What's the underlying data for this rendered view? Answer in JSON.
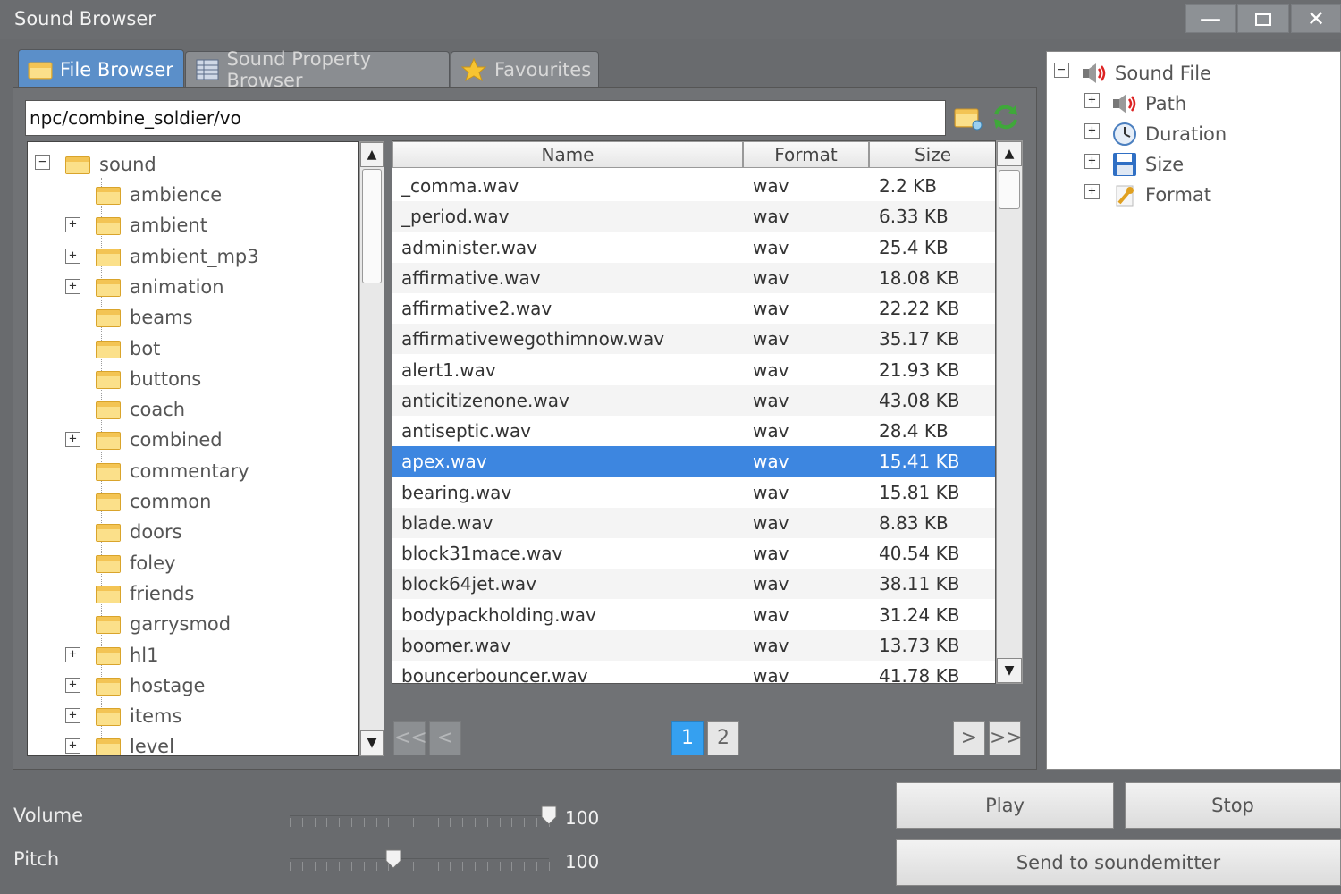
{
  "window": {
    "title": "Sound Browser"
  },
  "tabs": [
    {
      "label": "File Browser",
      "icon": "folder-icon",
      "active": true
    },
    {
      "label": "Sound Property Browser",
      "icon": "table-icon",
      "active": false
    },
    {
      "label": "Favourites",
      "icon": "star-icon",
      "active": false
    }
  ],
  "path": {
    "value": "npc/combine_soldier/vo"
  },
  "tree": {
    "root": "sound",
    "children": [
      {
        "label": "ambience",
        "expandable": false
      },
      {
        "label": "ambient",
        "expandable": true
      },
      {
        "label": "ambient_mp3",
        "expandable": true
      },
      {
        "label": "animation",
        "expandable": true
      },
      {
        "label": "beams",
        "expandable": false
      },
      {
        "label": "bot",
        "expandable": false
      },
      {
        "label": "buttons",
        "expandable": false
      },
      {
        "label": "coach",
        "expandable": false
      },
      {
        "label": "combined",
        "expandable": true
      },
      {
        "label": "commentary",
        "expandable": false
      },
      {
        "label": "common",
        "expandable": false
      },
      {
        "label": "doors",
        "expandable": false
      },
      {
        "label": "foley",
        "expandable": false
      },
      {
        "label": "friends",
        "expandable": false
      },
      {
        "label": "garrysmod",
        "expandable": false
      },
      {
        "label": "hl1",
        "expandable": true
      },
      {
        "label": "hostage",
        "expandable": true
      },
      {
        "label": "items",
        "expandable": true
      },
      {
        "label": "level",
        "expandable": true
      }
    ]
  },
  "filelist": {
    "columns": [
      "Name",
      "Format",
      "Size"
    ],
    "rows": [
      {
        "name": "_comma.wav",
        "format": "wav",
        "size": "2.2 KB"
      },
      {
        "name": "_period.wav",
        "format": "wav",
        "size": "6.33 KB"
      },
      {
        "name": "administer.wav",
        "format": "wav",
        "size": "25.4 KB"
      },
      {
        "name": "affirmative.wav",
        "format": "wav",
        "size": "18.08 KB"
      },
      {
        "name": "affirmative2.wav",
        "format": "wav",
        "size": "22.22 KB"
      },
      {
        "name": "affirmativewegothimnow.wav",
        "format": "wav",
        "size": "35.17 KB"
      },
      {
        "name": "alert1.wav",
        "format": "wav",
        "size": "21.93 KB"
      },
      {
        "name": "anticitizenone.wav",
        "format": "wav",
        "size": "43.08 KB"
      },
      {
        "name": "antiseptic.wav",
        "format": "wav",
        "size": "28.4 KB"
      },
      {
        "name": "apex.wav",
        "format": "wav",
        "size": "15.41 KB",
        "selected": true
      },
      {
        "name": "bearing.wav",
        "format": "wav",
        "size": "15.81 KB"
      },
      {
        "name": "blade.wav",
        "format": "wav",
        "size": "8.83 KB"
      },
      {
        "name": "block31mace.wav",
        "format": "wav",
        "size": "40.54 KB"
      },
      {
        "name": "block64jet.wav",
        "format": "wav",
        "size": "38.11 KB"
      },
      {
        "name": "bodypackholding.wav",
        "format": "wav",
        "size": "31.24 KB"
      },
      {
        "name": "boomer.wav",
        "format": "wav",
        "size": "13.73 KB"
      },
      {
        "name": "bouncerbouncer.wav",
        "format": "wav",
        "size": "41.78 KB"
      }
    ]
  },
  "pager": {
    "first": "<<",
    "prev": "<",
    "pages": [
      "1",
      "2"
    ],
    "current_page": "1",
    "next": ">",
    "last": ">>"
  },
  "properties": {
    "root": "Sound File",
    "items": [
      "Path",
      "Duration",
      "Size",
      "Format"
    ]
  },
  "controls": {
    "volume": {
      "label": "Volume",
      "value": "100",
      "level": 1.0
    },
    "pitch": {
      "label": "Pitch",
      "value": "100",
      "level": 0.4
    }
  },
  "buttons": {
    "play": "Play",
    "stop": "Stop",
    "send": "Send to soundemitter"
  },
  "colors": {
    "selection": "#3d86e0",
    "active_tab": "#5b8fc9",
    "current_page": "#35a0f0"
  }
}
